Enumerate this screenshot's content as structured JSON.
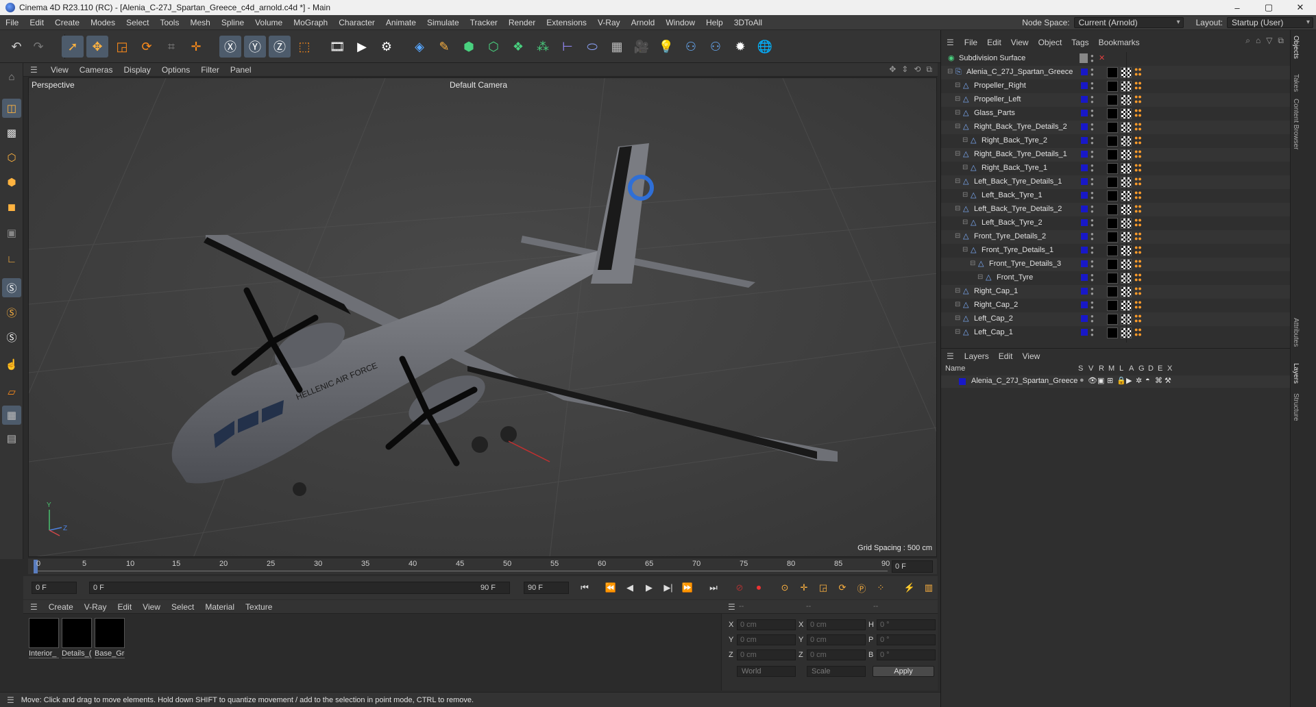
{
  "window": {
    "title": "Cinema 4D R23.110 (RC) - [Alenia_C-27J_Spartan_Greece_c4d_arnold.c4d *] - Main",
    "minimize": "–",
    "maximize": "▢",
    "close": "✕"
  },
  "menu": {
    "items": [
      "File",
      "Edit",
      "Create",
      "Modes",
      "Select",
      "Tools",
      "Mesh",
      "Spline",
      "Volume",
      "MoGraph",
      "Character",
      "Animate",
      "Simulate",
      "Tracker",
      "Render",
      "Extensions",
      "V-Ray",
      "Arnold",
      "Window",
      "Help",
      "3DToAll"
    ],
    "node_space_label": "Node Space:",
    "node_space_value": "Current (Arnold)",
    "layout_label": "Layout:",
    "layout_value": "Startup (User)"
  },
  "viewport": {
    "menu": [
      "View",
      "Cameras",
      "Display",
      "Options",
      "Filter",
      "Panel"
    ],
    "label": "Perspective",
    "camera": "Default Camera",
    "grid_spacing": "Grid Spacing : 500 cm",
    "axis_y": "Y",
    "axis_z": "Z"
  },
  "timeline": {
    "ticks": [
      "0",
      "5",
      "10",
      "15",
      "20",
      "25",
      "30",
      "35",
      "40",
      "45",
      "50",
      "55",
      "60",
      "65",
      "70",
      "75",
      "80",
      "85",
      "90"
    ],
    "current_frame": "0 F"
  },
  "transport": {
    "start_field": "0 F",
    "range_start": "0 F",
    "range_end": "90 F",
    "end_field": "90 F"
  },
  "materials": {
    "menu": [
      "Create",
      "V-Ray",
      "Edit",
      "View",
      "Select",
      "Material",
      "Texture"
    ],
    "items": [
      "Interior_",
      "Details_(",
      "Base_Gre"
    ]
  },
  "coords": {
    "headers": [
      "--",
      "--",
      "--"
    ],
    "x_label": "X",
    "y_label": "Y",
    "z_label": "Z",
    "h_label": "H",
    "p_label": "P",
    "b_label": "B",
    "pos_x": "0 cm",
    "pos_y": "0 cm",
    "pos_z": "0 cm",
    "size_x": "0 cm",
    "size_y": "0 cm",
    "size_z": "0 cm",
    "rot_h": "0 °",
    "rot_p": "0 °",
    "rot_b": "0 °",
    "space_dd": "World",
    "mode_dd": "Scale",
    "apply": "Apply"
  },
  "status": "Move: Click and drag to move elements. Hold down SHIFT to quantize movement / add to the selection in point mode, CTRL to remove.",
  "objects": {
    "menu": [
      "File",
      "Edit",
      "View",
      "Object",
      "Tags",
      "Bookmarks"
    ],
    "rows": [
      {
        "name": "Subdivision Surface",
        "indent": 0
      },
      {
        "name": "Alenia_C_27J_Spartan_Greece",
        "indent": 1
      },
      {
        "name": "Propeller_Right",
        "indent": 2
      },
      {
        "name": "Propeller_Left",
        "indent": 2
      },
      {
        "name": "Glass_Parts",
        "indent": 2
      },
      {
        "name": "Right_Back_Tyre_Details_2",
        "indent": 2
      },
      {
        "name": "Right_Back_Tyre_2",
        "indent": 3
      },
      {
        "name": "Right_Back_Tyre_Details_1",
        "indent": 2
      },
      {
        "name": "Right_Back_Tyre_1",
        "indent": 3
      },
      {
        "name": "Left_Back_Tyre_Details_1",
        "indent": 2
      },
      {
        "name": "Left_Back_Tyre_1",
        "indent": 3
      },
      {
        "name": "Left_Back_Tyre_Details_2",
        "indent": 2
      },
      {
        "name": "Left_Back_Tyre_2",
        "indent": 3
      },
      {
        "name": "Front_Tyre_Details_2",
        "indent": 2
      },
      {
        "name": "Front_Tyre_Details_1",
        "indent": 3
      },
      {
        "name": "Front_Tyre_Details_3",
        "indent": 4
      },
      {
        "name": "Front_Tyre",
        "indent": 5
      },
      {
        "name": "Right_Cap_1",
        "indent": 2
      },
      {
        "name": "Right_Cap_2",
        "indent": 2
      },
      {
        "name": "Left_Cap_2",
        "indent": 2
      },
      {
        "name": "Left_Cap_1",
        "indent": 2
      }
    ]
  },
  "layers": {
    "menu": [
      "Layers",
      "Edit",
      "View"
    ],
    "col_name": "Name",
    "cols": [
      "S",
      "V",
      "R",
      "M",
      "L",
      "A",
      "G",
      "D",
      "E",
      "X"
    ],
    "row_name": "Alenia_C_27J_Spartan_Greece",
    "layer_color": "#1818c8"
  },
  "side_tabs": [
    "Objects",
    "Takes",
    "Content Browser",
    "Attributes",
    "Layers",
    "Structure"
  ]
}
